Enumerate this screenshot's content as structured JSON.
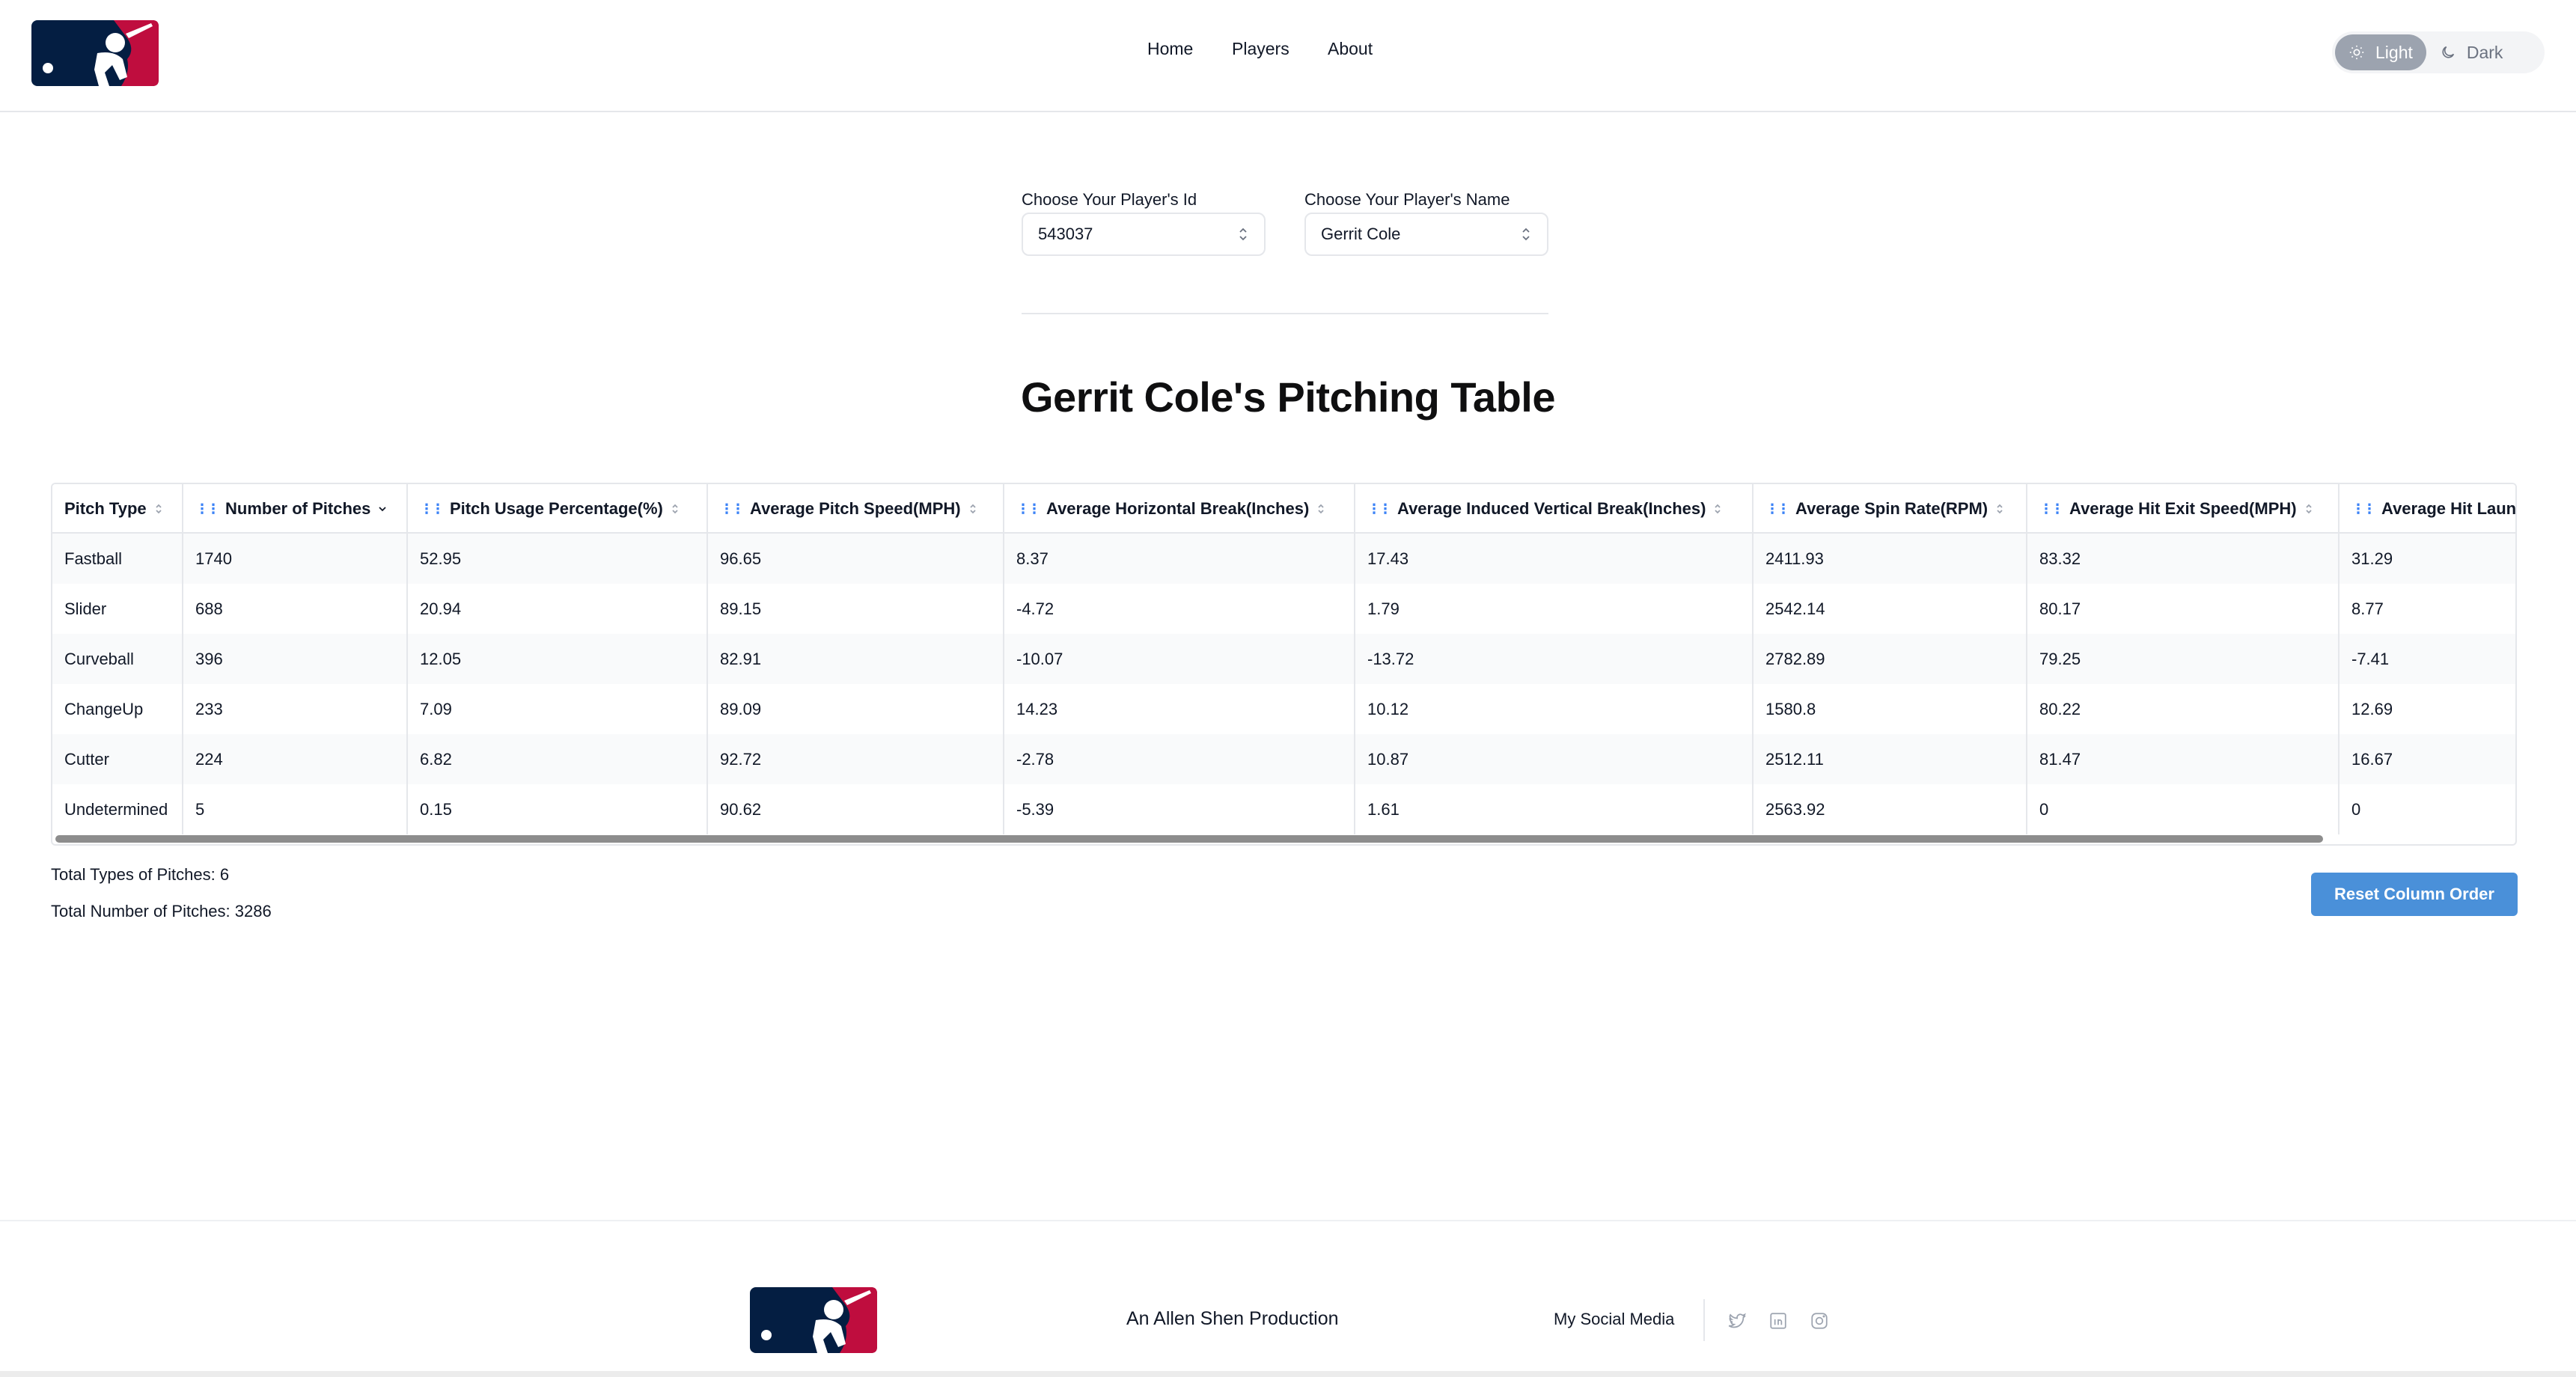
{
  "header": {
    "nav": [
      "Home",
      "Players",
      "About"
    ],
    "theme": {
      "light_label": "Light",
      "dark_label": "Dark",
      "active": "Light"
    }
  },
  "selectors": {
    "id_label": "Choose Your Player's Id",
    "id_value": "543037",
    "name_label": "Choose Your Player's Name",
    "name_value": "Gerrit Cole"
  },
  "page_title": "Gerrit Cole's Pitching Table",
  "table": {
    "columns": [
      "Pitch Type",
      "Number of Pitches",
      "Pitch Usage Percentage(%)",
      "Average Pitch Speed(MPH)",
      "Average Horizontal Break(Inches)",
      "Average Induced Vertical Break(Inches)",
      "Average Spin Rate(RPM)",
      "Average Hit Exit Speed(MPH)",
      "Average Hit Laun"
    ],
    "rows": [
      [
        "Fastball",
        "1740",
        "52.95",
        "96.65",
        "8.37",
        "17.43",
        "2411.93",
        "83.32",
        "31.29"
      ],
      [
        "Slider",
        "688",
        "20.94",
        "89.15",
        "-4.72",
        "1.79",
        "2542.14",
        "80.17",
        "8.77"
      ],
      [
        "Curveball",
        "396",
        "12.05",
        "82.91",
        "-10.07",
        "-13.72",
        "2782.89",
        "79.25",
        "-7.41"
      ],
      [
        "ChangeUp",
        "233",
        "7.09",
        "89.09",
        "14.23",
        "10.12",
        "1580.8",
        "80.22",
        "12.69"
      ],
      [
        "Cutter",
        "224",
        "6.82",
        "92.72",
        "-2.78",
        "10.87",
        "2512.11",
        "81.47",
        "16.67"
      ],
      [
        "Undetermined",
        "5",
        "0.15",
        "90.62",
        "-5.39",
        "1.61",
        "2563.92",
        "0",
        "0"
      ]
    ]
  },
  "summary": {
    "total_types": "Total Types of Pitches: 6",
    "total_pitches": "Total Number of Pitches: 3286"
  },
  "reset_button": "Reset Column Order",
  "footer": {
    "credit": "An Allen Shen Production",
    "social_label": "My Social Media",
    "social_icons": [
      "twitter-icon",
      "linkedin-icon",
      "instagram-icon"
    ]
  },
  "colors": {
    "mlb_navy": "#041e42",
    "mlb_red": "#bf0d3e",
    "accent_blue": "#4a90d9",
    "grip_blue": "#3b82f6"
  }
}
